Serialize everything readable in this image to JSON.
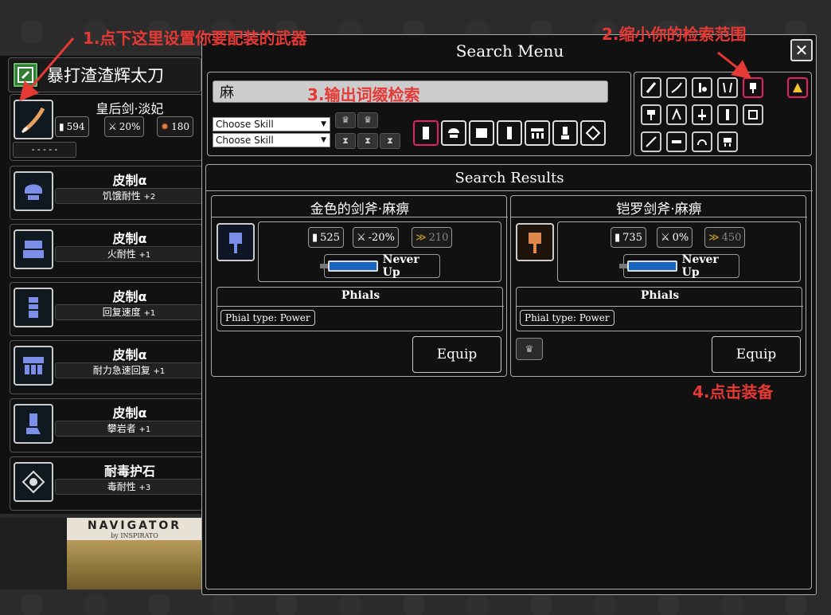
{
  "left_panel": {
    "weapon_name": "暴打渣渣辉太刀",
    "weapon": {
      "name": "皇后剑·淡妃",
      "attack": "594",
      "affinity": "20%",
      "element": "180",
      "deco": "- - - - -"
    },
    "armor": [
      {
        "title": "皮制α",
        "skill": "饥饿耐性",
        "level": "+2"
      },
      {
        "title": "皮制α",
        "skill": "火耐性",
        "level": "+1"
      },
      {
        "title": "皮制α",
        "skill": "回复速度",
        "level": "+1"
      },
      {
        "title": "皮制α",
        "skill": "耐力急速回复",
        "level": "+1"
      },
      {
        "title": "皮制α",
        "skill": "攀岩者",
        "level": "+1"
      }
    ],
    "charm": {
      "title": "耐毒护石",
      "skill": "毒耐性",
      "level": "+3"
    }
  },
  "ad": {
    "title": "NAVIGATOR",
    "subtitle": "by INSPIRATO"
  },
  "search_menu": {
    "title": "Search Menu",
    "close": "✕",
    "search_value": "麻",
    "skill_select_1": "Choose Skill",
    "skill_select_2": "Choose Skill",
    "results_title": "Search Results",
    "results": [
      {
        "name": "金色的剑斧·麻痹",
        "attack": "525",
        "affinity": "-20%",
        "element": "210",
        "sharpness": "Never Up",
        "phials_title": "Phials",
        "phial_type": "Phial type: Power",
        "equip": "Equip",
        "icon_color": "#7b8fe8"
      },
      {
        "name": "铠罗剑斧·麻痹",
        "attack": "735",
        "affinity": "0%",
        "element": "450",
        "sharpness": "Never Up",
        "phials_title": "Phials",
        "phial_type": "Phial type: Power",
        "equip": "Equip",
        "icon_color": "#e0874b"
      }
    ]
  },
  "annotations": {
    "a1": "1.点下这里设置你要配装的武器",
    "a2": "2.缩小你的检索范围",
    "a3": "3.输出词缀检索",
    "a4": "4.点击装备"
  },
  "colors": {
    "accent": "#e91e63",
    "annotation": "#e53935",
    "sharp_blue": "#1565c0"
  }
}
